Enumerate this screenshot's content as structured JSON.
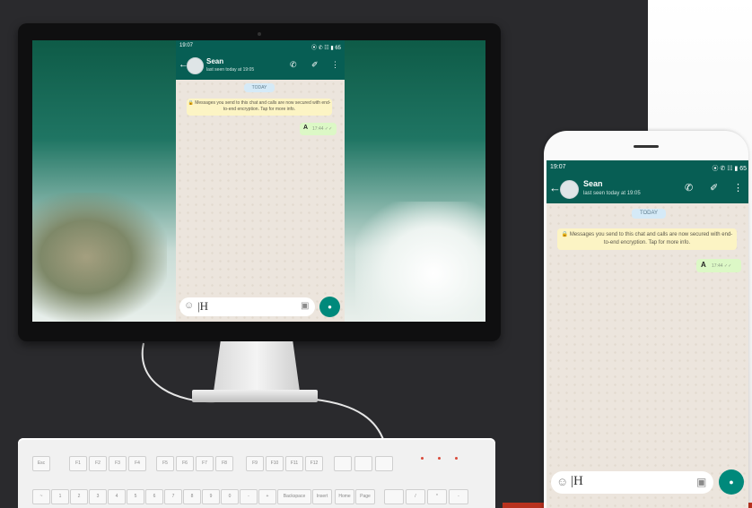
{
  "monitor_chat": {
    "status_time": "19:07",
    "status_icons": "⦿ ✆ ☷ ▮ 65",
    "back_icon": "←",
    "contact_name": "Sean",
    "last_seen": "last seen today at 19:05",
    "call_icon": "✆",
    "attach_icon": "✐",
    "more_icon": "⋮",
    "date_label": "TODAY",
    "encryption_notice": "🔒 Messages you send to this chat and calls are now secured with end-to-end encryption. Tap for more info.",
    "message_text": "A",
    "message_time": "17:44 ✓✓",
    "emoji_icon": "☺",
    "typed_text": "|H",
    "camera_icon": "▣",
    "mic_icon": "●"
  },
  "phone_chat": {
    "status_time": "19:07",
    "status_icons": "⦿ ✆ ☷ ▮ 65",
    "back_icon": "←",
    "contact_name": "Sean",
    "last_seen": "last seen today at 19:05",
    "call_icon": "✆",
    "attach_icon": "✐",
    "more_icon": "⋮",
    "date_label": "TODAY",
    "encryption_notice": "🔒 Messages you send to this chat and calls are now secured with end-to-end encryption. Tap for more info.",
    "message_text": "A",
    "message_time": "17:44 ✓✓",
    "emoji_icon": "☺",
    "typed_text": "|H",
    "camera_icon": "▣",
    "mic_icon": "●"
  },
  "keyboard": {
    "function_row": [
      "Esc",
      "F1",
      "F2",
      "F3",
      "F4",
      "F5",
      "F6",
      "F7",
      "F8",
      "F9",
      "F10",
      "F11",
      "F12",
      "",
      "",
      ""
    ],
    "number_row": [
      "~",
      "1",
      "2",
      "3",
      "4",
      "5",
      "6",
      "7",
      "8",
      "9",
      "0",
      "-",
      "+",
      "Backspace",
      "Insert",
      "Home",
      "Page",
      "",
      "/",
      "*",
      "-"
    ]
  },
  "colors": {
    "whatsapp_green": "#075e54",
    "chat_bg": "#ece5dd",
    "bubble_out": "#dcf8c6",
    "mic_button": "#00897b"
  }
}
